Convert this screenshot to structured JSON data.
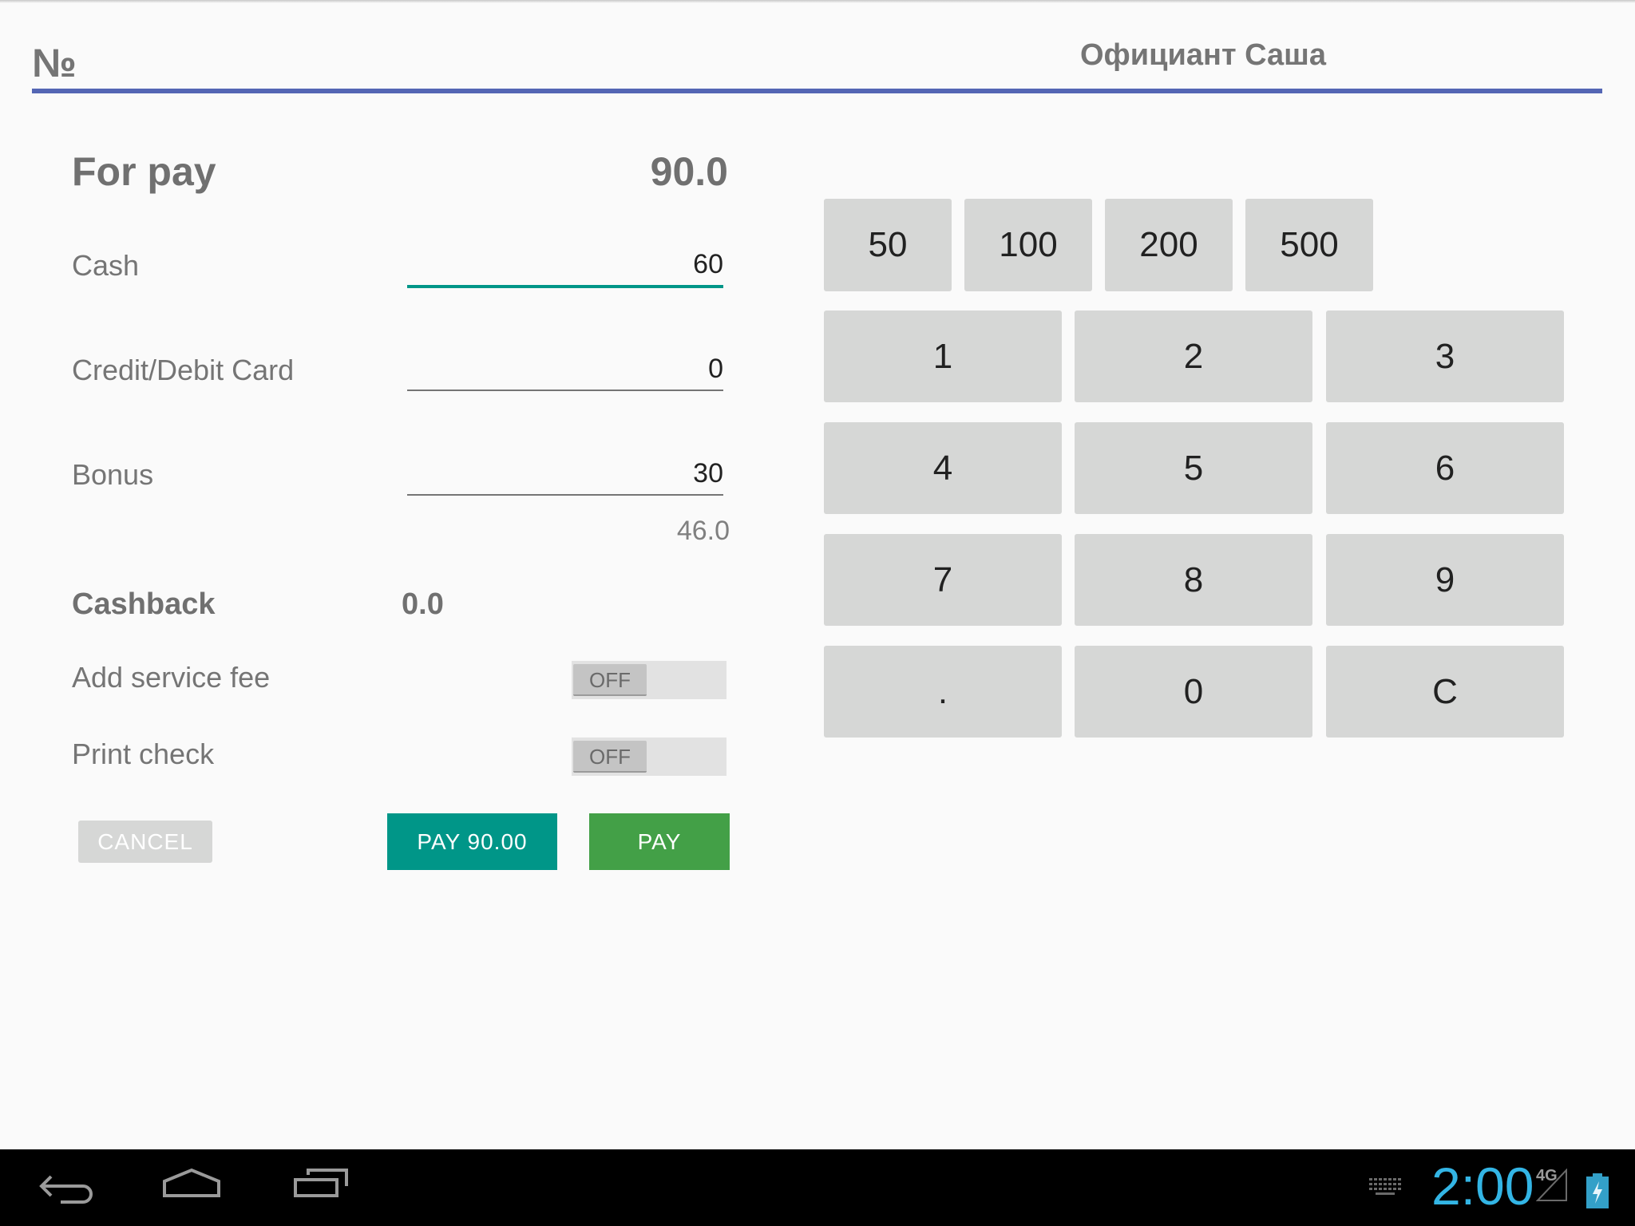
{
  "header": {
    "order_number_label": "№",
    "waiter": "Официант Саша"
  },
  "payment": {
    "for_pay_label": "For pay",
    "for_pay_value": "90.0",
    "fields": [
      {
        "label": "Cash",
        "value": "60",
        "focused": true
      },
      {
        "label": "Credit/Debit Card",
        "value": "0",
        "focused": false
      },
      {
        "label": "Bonus",
        "value": "30",
        "focused": false
      }
    ],
    "bonus_balance": "46.0",
    "cashback_label": "Cashback",
    "cashback_value": "0.0",
    "toggles": [
      {
        "label": "Add service fee",
        "state": "OFF"
      },
      {
        "label": "Print check",
        "state": "OFF"
      }
    ]
  },
  "actions": {
    "cancel": "CANCEL",
    "pay_amount": "PAY 90.00",
    "pay": "PAY"
  },
  "quick_amounts": [
    "50",
    "100",
    "200",
    "500"
  ],
  "keypad": [
    "1",
    "2",
    "3",
    "4",
    "5",
    "6",
    "7",
    "8",
    "9",
    ".",
    "0",
    "C"
  ],
  "colors": {
    "accent_blue": "#5466b4",
    "teal": "#009688",
    "green": "#43a047",
    "clock_blue": "#33b5e5"
  },
  "system_bar": {
    "time": "2:00",
    "network": "4G",
    "icons": [
      "back-icon",
      "home-icon",
      "recent-apps-icon",
      "keyboard-icon",
      "signal-icon",
      "battery-charging-icon"
    ]
  }
}
